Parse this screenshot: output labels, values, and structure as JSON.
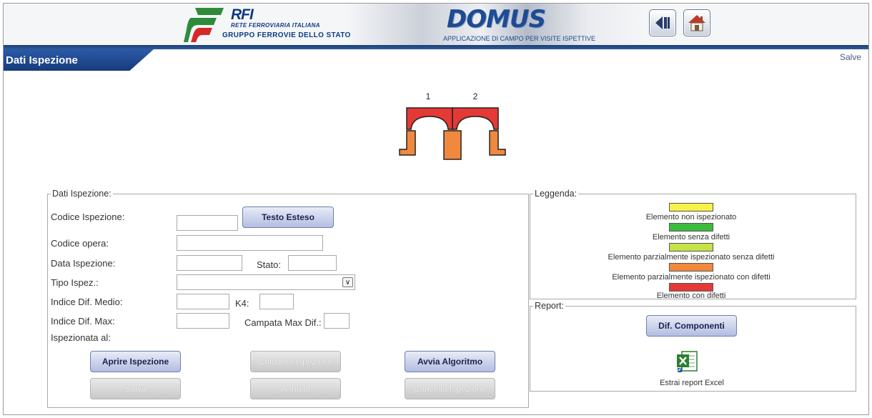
{
  "header": {
    "brand_big": "RFI",
    "brand_sub": "RETE FERROVIARIA ITALIANA",
    "brand_group": "GRUPPO FERROVIE DELLO STATO",
    "app_title": "DOMUS",
    "app_subtitle": "APPLICAZIONE DI CAMPO PER VISITE ISPETTIVE",
    "back_icon": "back-arrow-icon",
    "home_icon": "home-icon"
  },
  "page": {
    "title": "Dati Ispezione",
    "salve": "Salve"
  },
  "bridge": {
    "span_labels": [
      "1",
      "2"
    ],
    "colors": {
      "deck": "#e53935",
      "pier": "#f0883e",
      "outline": "#222222"
    }
  },
  "form": {
    "legend": "Dati Ispezione:",
    "codice_ispezione_label": "Codice Ispezione:",
    "codice_opera_label": "Codice opera:",
    "data_ispezione_label": "Data Ispezione:",
    "stato_label": "Stato:",
    "tipo_ispez_label": "Tipo Ispez.:",
    "indice_medio_label": "Indice Dif. Medio:",
    "k4_label": "K4:",
    "indice_max_label": "Indice Dif. Max:",
    "campata_label": "Campata Max Dif.:",
    "ispezionata_label": "Ispezionata al:",
    "buttons": {
      "testo_esteso": "Testo Esteso",
      "aprire": "Aprire Ispezione",
      "chiudere": "Chiudere Ispezione",
      "avvia": "Avvia Algoritmo",
      "salva": "Salva",
      "annulla": "Annulla",
      "cancella": "Cancella Ispezione"
    }
  },
  "legenda": {
    "legend": "Leggenda:",
    "items": [
      {
        "label": "Elemento non ispezionato",
        "color": "#f7f24a"
      },
      {
        "label": "Elemento senza difetti",
        "color": "#3dbb3d"
      },
      {
        "label": "Elemento parzialmente ispezionato senza difetti",
        "color": "#c6e24a"
      },
      {
        "label": "Elemento parzialmente ispezionato con difetti",
        "color": "#f0883e"
      },
      {
        "label": "Elemento con difetti",
        "color": "#e53935"
      }
    ]
  },
  "report": {
    "legend": "Report:",
    "dif_componenti": "Dif. Componenti",
    "excel_label": "Estrai report Excel",
    "excel_icon": "excel-icon"
  }
}
